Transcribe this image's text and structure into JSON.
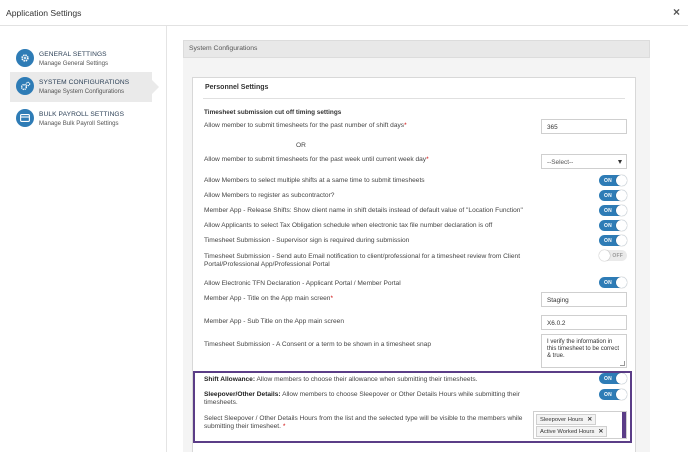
{
  "window": {
    "title": "Application Settings",
    "close_label": "×"
  },
  "sidebar": {
    "items": [
      {
        "title": "GENERAL SETTINGS",
        "subtitle": "Manage General Settings",
        "icon": "gear-icon"
      },
      {
        "title": "SYSTEM CONFIGURATIONS",
        "subtitle": "Manage System Configurations",
        "icon": "gears-icon"
      },
      {
        "title": "BULK PAYROLL SETTINGS",
        "subtitle": "Manage Bulk Payroll Settings",
        "icon": "card-icon"
      }
    ]
  },
  "section": {
    "header": "System Configurations",
    "panel_title": "Personnel Settings"
  },
  "timesheet": {
    "heading": "Timesheet submission cut off timing settings",
    "past_days_label": "Allow member to submit timesheets for the past number of shift days",
    "past_days_value": "365",
    "or_label": "OR",
    "past_week_label": "Allow member to submit timesheets for the past week until current week day",
    "past_week_selected": "--Select--"
  },
  "settings": [
    {
      "label": "Allow Members to select multiple shifts at a same time to submit timesheets",
      "state": "ON"
    },
    {
      "label": "Allow Members to register as subcontractor?",
      "state": "ON"
    },
    {
      "label": "Member App - Release Shifts: Show client name in shift details instead of default value of \"Location Function\"",
      "state": "ON"
    },
    {
      "label": "Allow Applicants to select Tax Obligation schedule when electronic tax file number declaration is off",
      "state": "ON"
    },
    {
      "label": "Timesheet Submission - Supervisor sign is required during submission",
      "state": "ON"
    },
    {
      "label": "Timesheet Submission - Send auto Email notification to client/professional for a timesheet review from Client Portal/Professional App/Professional Portal",
      "state": "OFF"
    },
    {
      "label": "Allow Electronic TFN Declaration - Applicant Portal / Member Portal",
      "state": "ON"
    }
  ],
  "app_title": {
    "label": "Member App - Title on the App main screen",
    "value": "Staging"
  },
  "app_subtitle": {
    "label": "Member App - Sub Title on the App main screen",
    "value": "X6.0.2"
  },
  "consent": {
    "label": "Timesheet Submission - A Consent or a term to be shown in a timesheet snap",
    "value": "I verify the information in this timesheet to be correct & true."
  },
  "shift_allowance": {
    "bold": "Shift Allowance:",
    "label": "Allow members to choose their allowance when submitting their timesheets.",
    "state": "ON"
  },
  "sleepover": {
    "bold": "Sleepover/Other Details:",
    "label": "Allow members to choose Sleepover or Other Details Hours while submitting their timesheets.",
    "state": "ON"
  },
  "hours_select": {
    "label": "Select Sleepover / Other Details Hours from the list and the selected type will be visible to the members while submitting their timesheet.",
    "tags": [
      "Sleepover Hours",
      "Active Worked Hours"
    ],
    "remove_label": "✕"
  },
  "colors": {
    "accent": "#2e7cb6",
    "highlight": "#5b3d87",
    "required": "#cc0000"
  }
}
